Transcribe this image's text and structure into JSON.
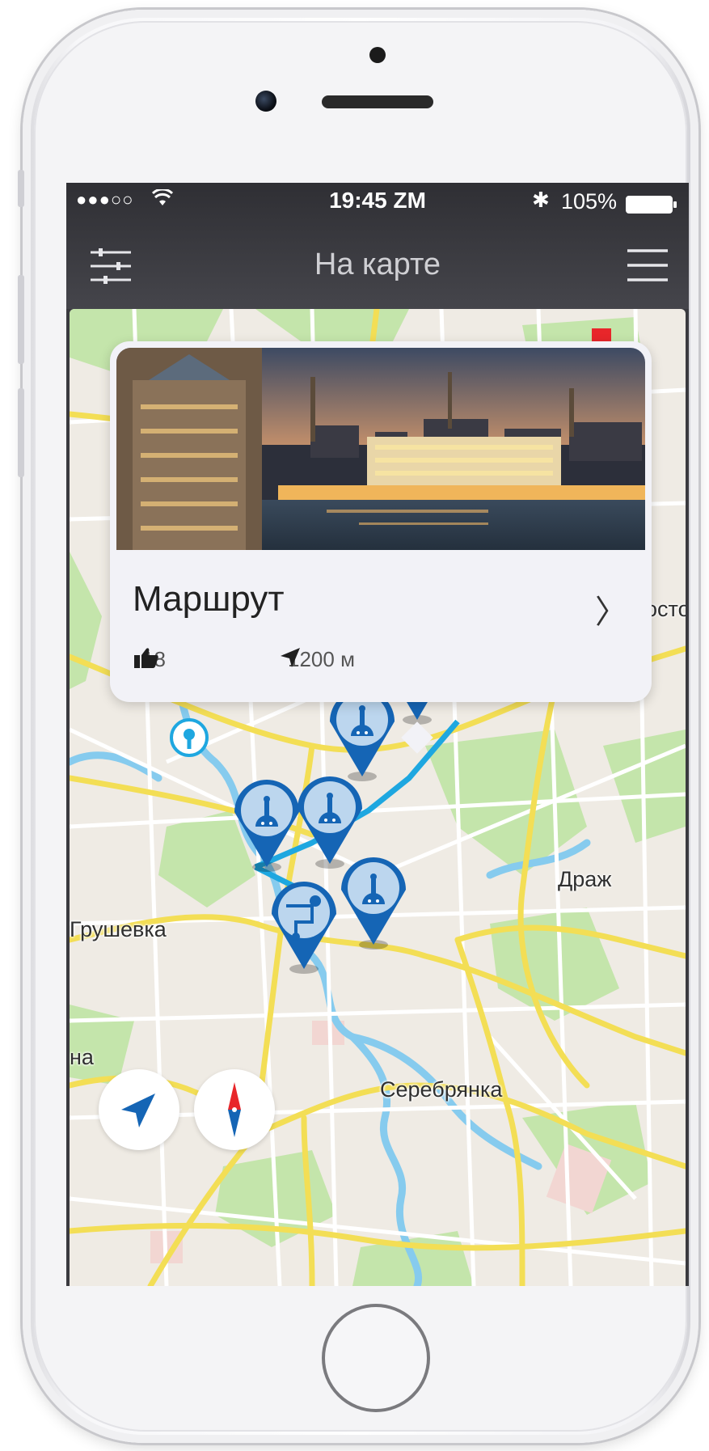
{
  "status_bar": {
    "signal": "●●●○○",
    "time": "19:45 ZM",
    "battery": "105%"
  },
  "nav": {
    "title": "На карте"
  },
  "card": {
    "title": "Маршрут",
    "likes": "18",
    "distance": "1200 м",
    "chevron": "〉"
  },
  "map": {
    "labels": {
      "grushevka": "Грушевка",
      "serebryanka": "Серебрянка",
      "drazh": "Драж",
      "na": "на",
      "osto": "осто"
    }
  },
  "colors": {
    "accent": "#1565b5",
    "route": "#1ea7e0",
    "pin_fill": "#bcd6ee",
    "road": "#f4e15c",
    "park": "#bfe3a5",
    "water": "#8fd0f0"
  },
  "icons": [
    "filter-icon",
    "menu-icon",
    "thumb-up-icon",
    "navigation-arrow-icon",
    "compass-icon",
    "monument-pin-icon",
    "route-start-pin-icon",
    "keyhole-pin-icon"
  ]
}
